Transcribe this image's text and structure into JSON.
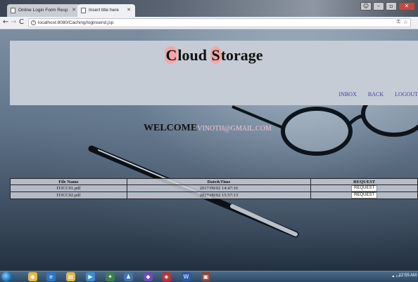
{
  "browser": {
    "tabs": [
      {
        "label": "Online Login Form Resp"
      },
      {
        "label": "Insert title here"
      }
    ],
    "url": "localhost:8080/Caching/loginsend.jsp"
  },
  "site": {
    "title_first_initial": "C",
    "title_first_rest": "loud ",
    "title_second_initial": "S",
    "title_second_rest": "torage",
    "nav": {
      "inbox": "INBOX",
      "back": "BACK",
      "logout": "LOGOUT"
    },
    "accent_color": "#f2a8a8",
    "link_color": "#3a3f9a"
  },
  "welcome": {
    "label": "WELCOME",
    "email": "VINOTH@GMAIL.COM"
  },
  "files_table": {
    "headers": {
      "file_name": "File Name",
      "date_time": "Date&Time",
      "request": "REQUEST"
    },
    "rows": [
      {
        "file_name": "ITJCC01.pdf",
        "date_time": "2017/09/02 14:47:16",
        "action": "REQUEST"
      },
      {
        "file_name": "ITJCC02.pdf",
        "date_time": "2017/09/02 15:57:13",
        "action": "REQUEST"
      }
    ]
  },
  "taskbar": {
    "clock": "12:55 AM",
    "apps": [
      "windows-explorer",
      "chrome",
      "internet-explorer",
      "file-explorer",
      "media-player",
      "app-leaf",
      "app-person",
      "app-purple",
      "app-red",
      "word",
      "app-scan"
    ]
  }
}
